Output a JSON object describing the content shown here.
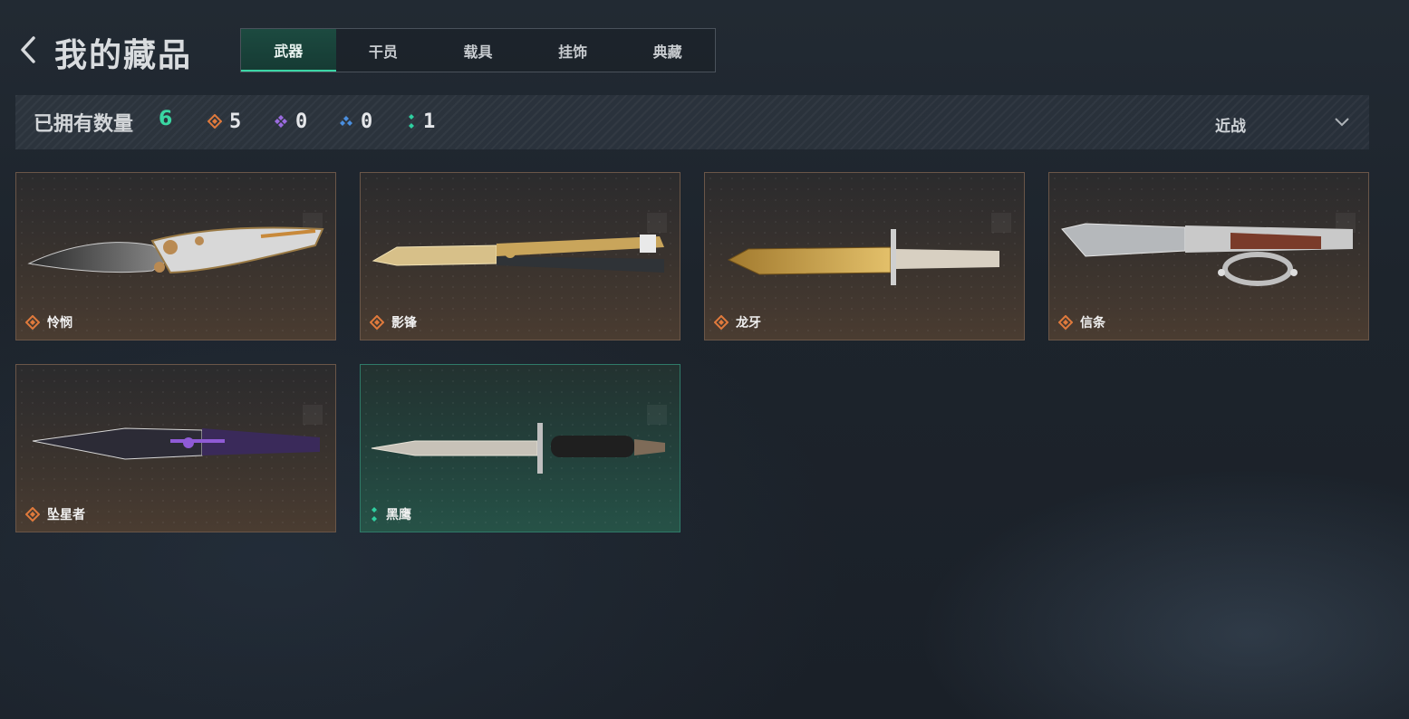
{
  "header": {
    "title": "我的藏品",
    "tabs": [
      {
        "label": "武器",
        "active": true
      },
      {
        "label": "干员",
        "active": false
      },
      {
        "label": "载具",
        "active": false
      },
      {
        "label": "挂饰",
        "active": false
      },
      {
        "label": "典藏",
        "active": false
      }
    ]
  },
  "summary": {
    "owned_label": "已拥有数量",
    "owned_total": "6",
    "rarity_counts": [
      {
        "icon": "orange-diamond-icon",
        "color": "#e07a3c",
        "count": "5"
      },
      {
        "icon": "purple-diamond-icon",
        "color": "#9b6be0",
        "count": "0"
      },
      {
        "icon": "blue-diamond-icon",
        "color": "#4a8fe0",
        "count": "0"
      },
      {
        "icon": "teal-dots-icon",
        "color": "#2fcfa0",
        "count": "1"
      }
    ],
    "filter_label": "近战"
  },
  "items": [
    {
      "name": "怜悯",
      "rarity_color": "#e07a3c"
    },
    {
      "name": "影锋",
      "rarity_color": "#e07a3c"
    },
    {
      "name": "龙牙",
      "rarity_color": "#e07a3c"
    },
    {
      "name": "信条",
      "rarity_color": "#e07a3c"
    },
    {
      "name": "坠星者",
      "rarity_color": "#e07a3c"
    },
    {
      "name": "黑鹰",
      "rarity_color": "#2fcfa0"
    }
  ]
}
